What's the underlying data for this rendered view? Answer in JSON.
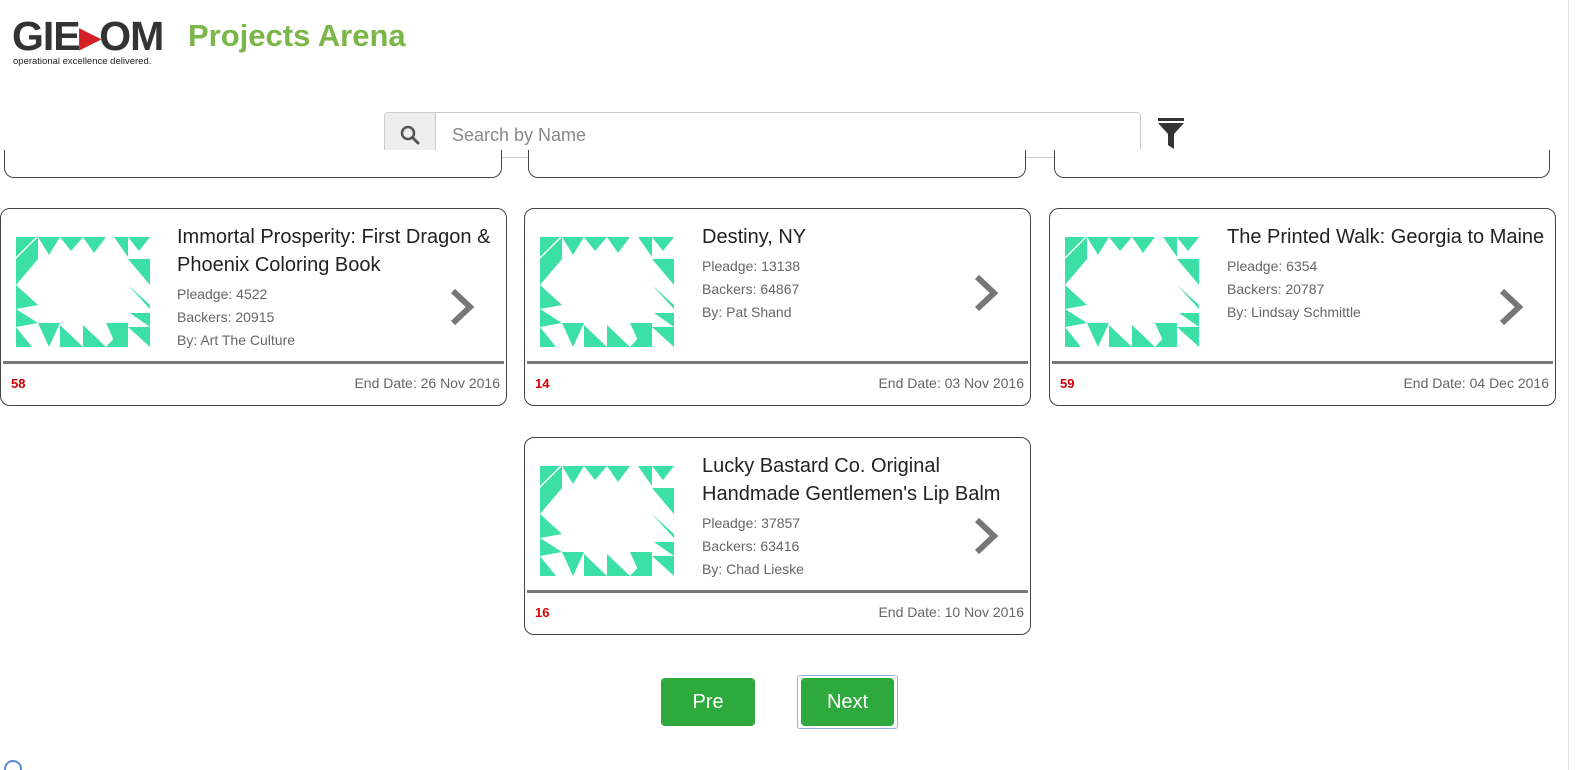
{
  "header": {
    "logo_text_a": "GIE",
    "logo_text_b": "OM",
    "logo_tagline": "operational excellence delivered.",
    "title": "Projects Arena",
    "title_color": "#7ab648"
  },
  "search": {
    "placeholder": "Search by Name",
    "value": "",
    "icon": "search-icon",
    "filter_icon": "filter-icon"
  },
  "cards": [
    {
      "title": "Immortal Prosperity: First Dragon & Phoenix Coloring Book",
      "pledge": "Pleadge: 4522",
      "backers": "Backers: 20915",
      "by": "By: Art The Culture",
      "days": "58",
      "end_date": "End Date: 26 Nov 2016"
    },
    {
      "title": "Destiny, NY",
      "pledge": "Pleadge: 13138",
      "backers": "Backers: 64867",
      "by": "By: Pat Shand",
      "days": "14",
      "end_date": "End Date: 03 Nov 2016"
    },
    {
      "title": "The Printed Walk: Georgia to Maine",
      "pledge": "Pleadge: 6354",
      "backers": "Backers: 20787",
      "by": "By: Lindsay Schmittle",
      "days": "59",
      "end_date": "End Date: 04 Dec 2016"
    },
    {
      "title": "Lucky Bastard Co. Original Handmade Gentlemen's Lip Balm",
      "pledge": "Pleadge: 37857",
      "backers": "Backers: 63416",
      "by": "By: Chad Lieske",
      "days": "16",
      "end_date": "End Date: 10 Nov 2016"
    }
  ],
  "pagination": {
    "pre_label": "Pre",
    "next_label": "Next",
    "button_color": "#2eaa3c"
  },
  "colors": {
    "identicon": "#3ce0a6",
    "days_red": "#d40000"
  }
}
